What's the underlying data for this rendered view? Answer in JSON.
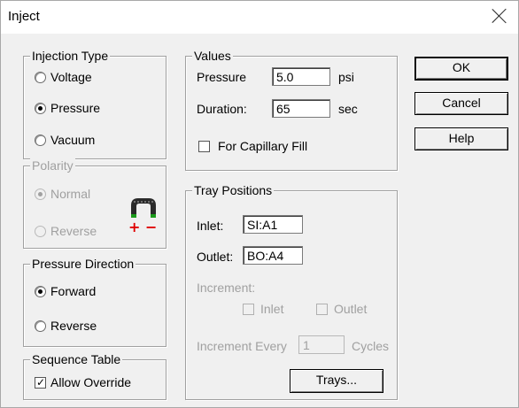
{
  "window": {
    "title": "Inject"
  },
  "injection_type": {
    "title": "Injection Type",
    "options": [
      {
        "label": "Voltage",
        "selected": false
      },
      {
        "label": "Pressure",
        "selected": true
      },
      {
        "label": "Vacuum",
        "selected": false
      }
    ]
  },
  "polarity": {
    "title": "Polarity",
    "enabled": false,
    "options": [
      {
        "label": "Normal",
        "selected": true
      },
      {
        "label": "Reverse",
        "selected": false
      }
    ],
    "plus": "+",
    "minus": "−"
  },
  "pressure_direction": {
    "title": "Pressure Direction",
    "options": [
      {
        "label": "Forward",
        "selected": true
      },
      {
        "label": "Reverse",
        "selected": false
      }
    ]
  },
  "sequence_table": {
    "title": "Sequence Table",
    "allow_override_label": "Allow Override",
    "allow_override_checked": true,
    "check_glyph": "✓"
  },
  "values": {
    "title": "Values",
    "pressure_label": "Pressure",
    "pressure_value": "5.0",
    "pressure_unit": "psi",
    "duration_label": "Duration:",
    "duration_value": "65",
    "duration_unit": "sec",
    "capillary_fill_label": "For Capillary Fill",
    "capillary_fill_checked": false
  },
  "tray_positions": {
    "title": "Tray Positions",
    "inlet_label": "Inlet:",
    "inlet_value": "SI:A1",
    "outlet_label": "Outlet:",
    "outlet_value": "BO:A4",
    "increment_label": "Increment:",
    "increment_inlet_label": "Inlet",
    "increment_outlet_label": "Outlet",
    "increment_every_label": "Increment Every",
    "increment_every_value": "1",
    "cycles_label": "Cycles",
    "trays_button": "Trays..."
  },
  "buttons": {
    "ok": "OK",
    "cancel": "Cancel",
    "help": "Help"
  }
}
